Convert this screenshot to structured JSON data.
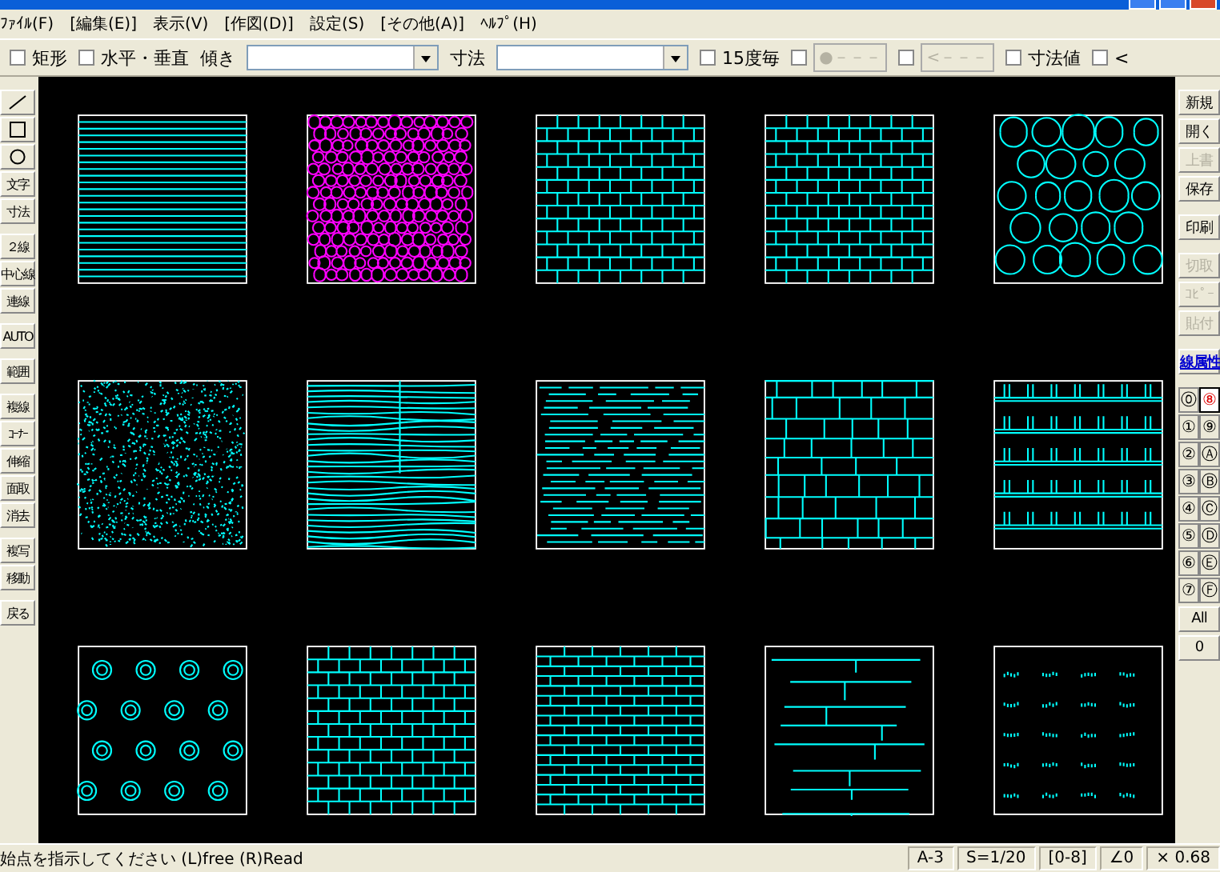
{
  "menu": [
    "ﾌｧｲﾙ(F)",
    "[編集(E)]",
    "表示(V)",
    "[作図(D)]",
    "設定(S)",
    "[その他(A)]",
    "ﾍﾙﾌﾟ(H)"
  ],
  "toolbar": [
    {
      "kind": "check",
      "label": "矩形",
      "checked": false
    },
    {
      "kind": "check",
      "label": "水平・垂直",
      "checked": false
    },
    {
      "kind": "label",
      "label": "傾き"
    },
    {
      "kind": "combo"
    },
    {
      "kind": "label",
      "label": "寸法"
    },
    {
      "kind": "combo"
    },
    {
      "kind": "check",
      "label": "15度毎",
      "checked": false
    },
    {
      "kind": "check-button",
      "label": "●－－－",
      "checked": false,
      "disabled": true
    },
    {
      "kind": "check-button",
      "label": "<－－－",
      "checked": false,
      "disabled": true
    },
    {
      "kind": "check",
      "label": "寸法値",
      "checked": false
    },
    {
      "kind": "check",
      "label": "<",
      "checked": false
    }
  ],
  "left_tools": [
    {
      "kind": "line"
    },
    {
      "kind": "rect"
    },
    {
      "kind": "circle"
    },
    {
      "kind": "text",
      "label": "文字"
    },
    {
      "kind": "text",
      "label": "寸法"
    },
    {
      "kind": "gap"
    },
    {
      "kind": "text",
      "label": "２線"
    },
    {
      "kind": "text",
      "label": "中心線"
    },
    {
      "kind": "text",
      "label": "連線"
    },
    {
      "kind": "gap"
    },
    {
      "kind": "text",
      "label": "AUTO"
    },
    {
      "kind": "gap"
    },
    {
      "kind": "text",
      "label": "範囲"
    },
    {
      "kind": "gap"
    },
    {
      "kind": "text",
      "label": "複線"
    },
    {
      "kind": "text",
      "label": "ｺｰﾅｰ"
    },
    {
      "kind": "text",
      "label": "伸縮"
    },
    {
      "kind": "text",
      "label": "面取"
    },
    {
      "kind": "text",
      "label": "消去"
    },
    {
      "kind": "gap"
    },
    {
      "kind": "text",
      "label": "複写"
    },
    {
      "kind": "text",
      "label": "移動"
    },
    {
      "kind": "gap"
    },
    {
      "kind": "text",
      "label": "戻る"
    }
  ],
  "right_tools": [
    {
      "kind": "text",
      "label": "新規",
      "disabled": false
    },
    {
      "kind": "text",
      "label": "開く",
      "disabled": false
    },
    {
      "kind": "text",
      "label": "上書",
      "disabled": true
    },
    {
      "kind": "text",
      "label": "保存",
      "disabled": false
    },
    {
      "kind": "gap"
    },
    {
      "kind": "text",
      "label": "印刷",
      "disabled": false
    },
    {
      "kind": "gap"
    },
    {
      "kind": "text",
      "label": "切取",
      "disabled": true
    },
    {
      "kind": "text",
      "label": "ｺﾋﾟｰ",
      "disabled": true
    },
    {
      "kind": "text",
      "label": "貼付",
      "disabled": true
    },
    {
      "kind": "gap"
    },
    {
      "kind": "link",
      "label": "線属性",
      "disabled": false
    }
  ],
  "layers": [
    {
      "label": "⓪",
      "selected": false
    },
    {
      "label": "⑧",
      "selected": true
    },
    {
      "label": "①",
      "selected": false
    },
    {
      "label": "⑨",
      "selected": false
    },
    {
      "label": "②",
      "selected": false
    },
    {
      "label": "Ⓐ",
      "selected": false
    },
    {
      "label": "③",
      "selected": false
    },
    {
      "label": "Ⓑ",
      "selected": false
    },
    {
      "label": "④",
      "selected": false
    },
    {
      "label": "Ⓒ",
      "selected": false
    },
    {
      "label": "⑤",
      "selected": false
    },
    {
      "label": "Ⓓ",
      "selected": false
    },
    {
      "label": "⑥",
      "selected": false
    },
    {
      "label": "Ⓔ",
      "selected": false
    },
    {
      "label": "⑦",
      "selected": false
    },
    {
      "label": "Ⓕ",
      "selected": false
    }
  ],
  "layer_buttons": [
    "All",
    "0"
  ],
  "tiles": [
    {
      "kind": "lines",
      "color": "#00ffff"
    },
    {
      "kind": "pebbles",
      "color": "#ff00ff"
    },
    {
      "kind": "brick",
      "color": "#00ffff"
    },
    {
      "kind": "brick",
      "color": "#00ffff"
    },
    {
      "kind": "stones",
      "color": "#00ffff"
    },
    {
      "kind": "speckle",
      "color": "#00ffff"
    },
    {
      "kind": "wood",
      "color": "#00ffff"
    },
    {
      "kind": "strips",
      "color": "#00ffff"
    },
    {
      "kind": "stonewall",
      "color": "#00ffff"
    },
    {
      "kind": "block",
      "color": "#00ffff"
    },
    {
      "kind": "rings",
      "color": "#00ffff"
    },
    {
      "kind": "brick",
      "color": "#00ffff"
    },
    {
      "kind": "fine-brick",
      "color": "#00ffff"
    },
    {
      "kind": "slab",
      "color": "#00ffff"
    },
    {
      "kind": "dots",
      "color": "#00ffff"
    }
  ],
  "status": {
    "message": "始点を指示してください (L)free (R)Read",
    "cells": [
      "A-3",
      "S=1/20",
      "[0-8]",
      "∠0",
      "× 0.68"
    ]
  }
}
